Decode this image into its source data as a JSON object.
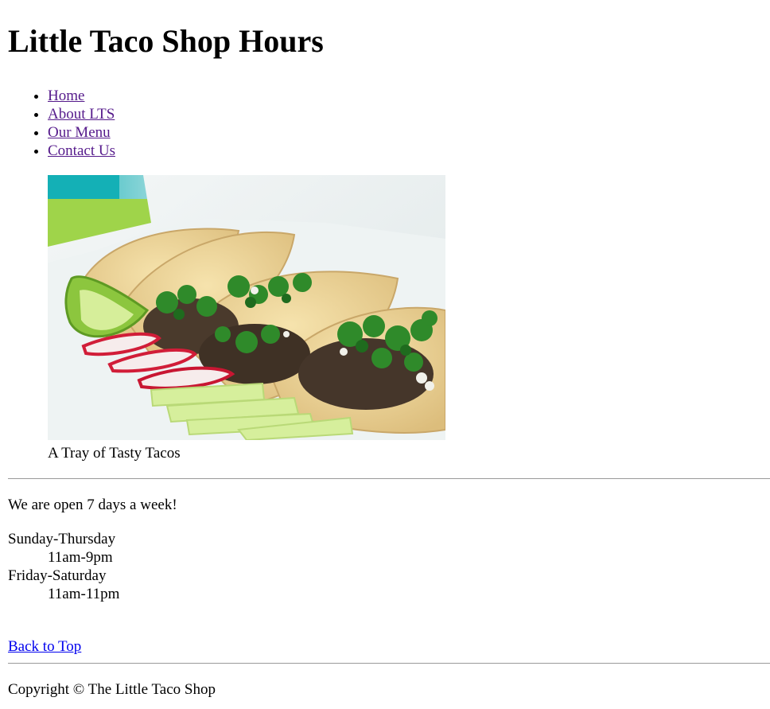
{
  "header": {
    "title": "Little Taco Shop Hours"
  },
  "nav": {
    "items": [
      {
        "label": "Home"
      },
      {
        "label": "About LTS"
      },
      {
        "label": "Our Menu"
      },
      {
        "label": "Contact Us"
      }
    ]
  },
  "figure": {
    "caption": "A Tray of Tasty Tacos"
  },
  "hours": {
    "intro": "We are open 7 days a week!",
    "schedule": [
      {
        "days": "Sunday-Thursday",
        "time": "11am-9pm"
      },
      {
        "days": "Friday-Saturday",
        "time": "11am-11pm"
      }
    ]
  },
  "links": {
    "back_to_top": "Back to Top"
  },
  "footer": {
    "copyright": "Copyright © The Little Taco Shop"
  },
  "colors": {
    "visited_link": "#551a8b",
    "link": "#0000ee",
    "rule": "#9a9a9a"
  }
}
